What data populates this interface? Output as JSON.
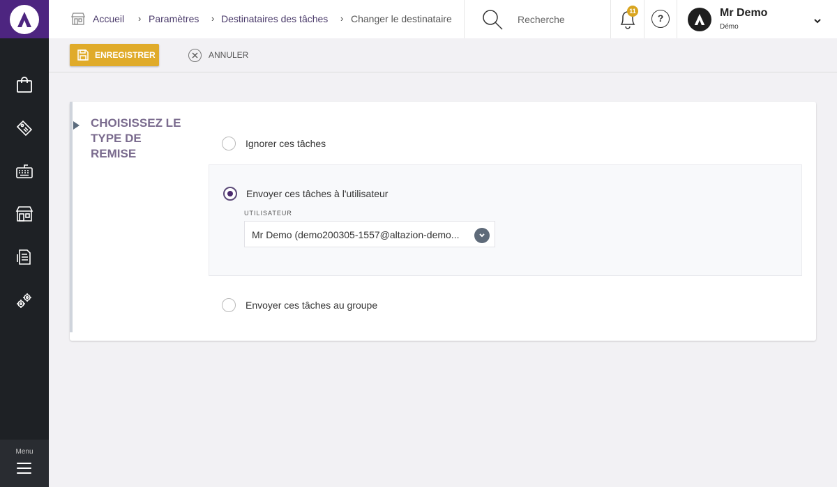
{
  "sidebar": {
    "logo": "altazion-logo",
    "items": [
      {
        "icon": "shopping-bag-icon"
      },
      {
        "icon": "price-tag-icon"
      },
      {
        "icon": "keyboard-icon"
      },
      {
        "icon": "storefront-icon"
      },
      {
        "icon": "document-icon"
      },
      {
        "icon": "gears-icon"
      }
    ],
    "menu_label": "Menu"
  },
  "header": {
    "breadcrumb": [
      "Accueil",
      "Paramètres",
      "Destinataires des tâches",
      "Changer le destinataire"
    ],
    "search_placeholder": "Recherche",
    "notification_count": "11",
    "help_label": "?",
    "user_name": "Mr Demo",
    "user_sub": "Démo"
  },
  "toolbar": {
    "save_label": "ENREGISTRER",
    "cancel_label": "ANNULER"
  },
  "section": {
    "title": "CHOISISSEZ LE TYPE DE REMISE",
    "options": [
      {
        "label": "Ignorer ces tâches",
        "checked": false
      },
      {
        "label": "Envoyer ces tâches à l'utilisateur",
        "checked": true
      },
      {
        "label": "Envoyer ces tâches au groupe",
        "checked": false
      }
    ],
    "user_field_label": "UTILISATEUR",
    "user_field_value": "Mr Demo (demo200305-1557@altazion-demo..."
  },
  "colors": {
    "brand_purple": "#4d2580",
    "save_yellow": "#e0ab2a",
    "sidebar_dark": "#1e2125"
  }
}
